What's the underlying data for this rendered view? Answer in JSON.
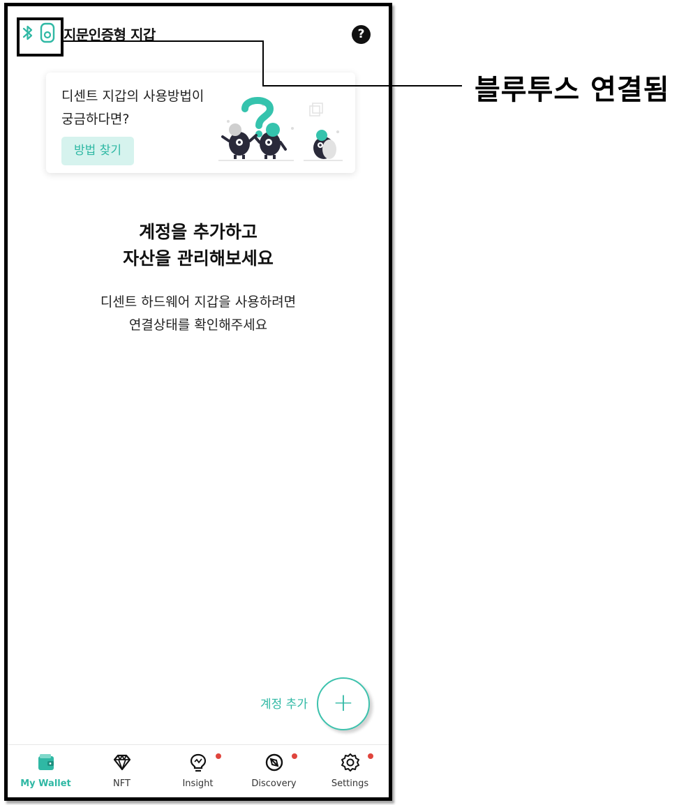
{
  "header": {
    "title": "지문인증형 지갑",
    "help_icon": "question-icon",
    "help_label": "?"
  },
  "tip_card": {
    "text_line1": "디센트 지갑의 사용방법이",
    "text_line2": "궁금하다면?",
    "button_label": "방법 찾기"
  },
  "empty_state": {
    "title_line1": "계정을 추가하고",
    "title_line2": "자산을 관리해보세요",
    "desc_line1": "디센트 하드웨어 지갑을 사용하려면",
    "desc_line2": "연결상태를 확인해주세요"
  },
  "fab": {
    "label": "계정 추가",
    "icon": "plus-icon",
    "symbol": "+"
  },
  "tabs": [
    {
      "label": "My Wallet",
      "icon": "wallet-icon",
      "active": true,
      "badge": false
    },
    {
      "label": "NFT",
      "icon": "diamond-icon",
      "active": false,
      "badge": false
    },
    {
      "label": "Insight",
      "icon": "lightbulb-icon",
      "active": false,
      "badge": true
    },
    {
      "label": "Discovery",
      "icon": "compass-icon",
      "active": false,
      "badge": true
    },
    {
      "label": "Settings",
      "icon": "gear-icon",
      "active": false,
      "badge": true
    }
  ],
  "annotation": {
    "callout": "블루투스 연결됨"
  },
  "colors": {
    "accent": "#2fb8a4",
    "badge": "#e0453d",
    "text": "#111111"
  }
}
